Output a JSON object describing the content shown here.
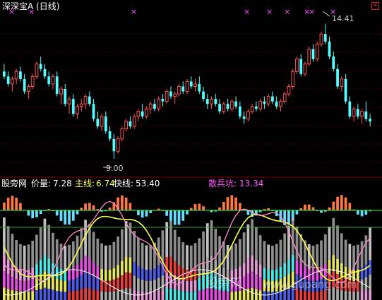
{
  "upper_panel": {
    "title": "深深宝A (日线)",
    "high_annotation": "14.41",
    "low_annotation": "9.00",
    "signal_marker": "×"
  },
  "lower_panel": {
    "indicator_name": "股旁网",
    "price_label": "价量:",
    "price_value": "7.28",
    "main_label": "主线:",
    "main_value": "6.74",
    "fast_label": "快线:",
    "fast_value": "53.40",
    "retail_label": "散兵坑:",
    "retail_value": "13.34"
  },
  "watermark": {
    "cn": "股旁网",
    "en": "www.gupang.com"
  },
  "colors": {
    "up": "#ff5555",
    "down": "#55ffff",
    "grid": "#7a0000",
    "price_label": "#ffffff",
    "main_label": "#ffff55",
    "fast_label": "#ffffff",
    "retail_label": "#ff55ff",
    "marker": "#ff55ff",
    "main_line": "#ffff44",
    "fast_line": "#ff88cc"
  },
  "chart_data": [
    {
      "type": "candlestick",
      "title": "深深宝A (日线)",
      "candles": [
        [
          12.5,
          12.8,
          12.2,
          12.3
        ],
        [
          12.3,
          12.5,
          11.9,
          12.0
        ],
        [
          12.0,
          12.3,
          11.7,
          12.2
        ],
        [
          12.2,
          12.6,
          12.0,
          12.5
        ],
        [
          12.5,
          12.7,
          12.1,
          12.2
        ],
        [
          12.2,
          12.4,
          11.6,
          11.7
        ],
        [
          11.7,
          12.0,
          11.4,
          11.9
        ],
        [
          11.9,
          12.4,
          11.8,
          12.3
        ],
        [
          12.3,
          12.9,
          12.2,
          12.8
        ],
        [
          12.8,
          13.1,
          12.5,
          12.6
        ],
        [
          12.6,
          12.8,
          12.2,
          12.3
        ],
        [
          12.3,
          12.5,
          11.9,
          12.0
        ],
        [
          12.0,
          12.4,
          11.8,
          12.3
        ],
        [
          12.3,
          12.5,
          11.5,
          11.6
        ],
        [
          11.6,
          11.9,
          11.2,
          11.8
        ],
        [
          11.8,
          12.0,
          11.1,
          11.2
        ],
        [
          11.2,
          11.5,
          10.8,
          11.4
        ],
        [
          11.4,
          11.6,
          10.7,
          10.8
        ],
        [
          10.8,
          11.2,
          10.6,
          11.1
        ],
        [
          11.1,
          11.4,
          10.9,
          11.2
        ],
        [
          11.2,
          11.6,
          11.0,
          11.5
        ],
        [
          11.5,
          11.7,
          11.1,
          11.2
        ],
        [
          11.2,
          11.4,
          10.5,
          10.6
        ],
        [
          10.6,
          10.9,
          10.2,
          10.3
        ],
        [
          10.3,
          10.8,
          10.1,
          10.7
        ],
        [
          10.7,
          10.9,
          10.0,
          10.1
        ],
        [
          10.1,
          10.3,
          9.7,
          9.8
        ],
        [
          9.8,
          10.0,
          9.0,
          9.3
        ],
        [
          9.3,
          9.9,
          9.2,
          9.8
        ],
        [
          9.8,
          10.3,
          9.7,
          10.2
        ],
        [
          10.2,
          10.6,
          10.1,
          10.5
        ],
        [
          10.5,
          10.7,
          10.2,
          10.3
        ],
        [
          10.3,
          10.8,
          10.2,
          10.7
        ],
        [
          10.7,
          11.0,
          10.5,
          10.9
        ],
        [
          10.9,
          11.2,
          10.6,
          10.7
        ],
        [
          10.7,
          11.1,
          10.6,
          11.0
        ],
        [
          11.0,
          11.3,
          10.8,
          11.2
        ],
        [
          11.2,
          11.4,
          10.9,
          11.0
        ],
        [
          11.0,
          11.5,
          10.9,
          11.4
        ],
        [
          11.4,
          11.6,
          11.1,
          11.3
        ],
        [
          11.3,
          11.8,
          11.2,
          11.7
        ],
        [
          11.7,
          11.9,
          11.4,
          11.5
        ],
        [
          11.5,
          11.7,
          11.2,
          11.6
        ],
        [
          11.6,
          12.0,
          11.5,
          11.9
        ],
        [
          11.9,
          12.1,
          11.6,
          11.7
        ],
        [
          11.7,
          12.2,
          11.6,
          12.1
        ],
        [
          12.1,
          12.3,
          11.8,
          11.9
        ],
        [
          11.9,
          12.2,
          11.7,
          12.0
        ],
        [
          12.0,
          12.3,
          11.6,
          11.7
        ],
        [
          11.7,
          11.9,
          11.3,
          11.4
        ],
        [
          11.4,
          11.6,
          11.0,
          11.2
        ],
        [
          11.2,
          11.5,
          11.0,
          11.4
        ],
        [
          11.4,
          11.6,
          11.1,
          11.2
        ],
        [
          11.2,
          11.4,
          10.8,
          10.9
        ],
        [
          10.9,
          11.3,
          10.8,
          11.2
        ],
        [
          11.2,
          11.4,
          10.9,
          11.0
        ],
        [
          11.0,
          11.4,
          10.9,
          11.3
        ],
        [
          11.3,
          11.5,
          11.0,
          11.1
        ],
        [
          11.1,
          11.3,
          10.6,
          10.7
        ],
        [
          10.7,
          10.9,
          10.4,
          10.6
        ],
        [
          10.6,
          11.0,
          10.5,
          10.9
        ],
        [
          10.9,
          11.2,
          10.8,
          11.1
        ],
        [
          11.1,
          11.3,
          10.9,
          11.0
        ],
        [
          11.0,
          11.4,
          10.9,
          11.3
        ],
        [
          11.3,
          11.5,
          11.0,
          11.2
        ],
        [
          11.2,
          11.6,
          11.1,
          11.5
        ],
        [
          11.5,
          11.7,
          11.2,
          11.3
        ],
        [
          11.3,
          11.5,
          11.0,
          11.1
        ],
        [
          11.1,
          11.4,
          10.9,
          11.3
        ],
        [
          11.3,
          11.7,
          11.2,
          11.6
        ],
        [
          11.6,
          12.0,
          11.5,
          11.9
        ],
        [
          11.9,
          12.6,
          11.8,
          12.5
        ],
        [
          12.5,
          13.1,
          12.4,
          13.0
        ],
        [
          13.0,
          13.2,
          12.3,
          12.4
        ],
        [
          12.4,
          12.9,
          12.3,
          12.8
        ],
        [
          12.8,
          13.5,
          12.7,
          13.4
        ],
        [
          13.4,
          13.6,
          12.9,
          13.0
        ],
        [
          13.0,
          13.7,
          12.9,
          13.6
        ],
        [
          13.6,
          14.1,
          13.5,
          14.0
        ],
        [
          14.0,
          14.41,
          13.6,
          13.7
        ],
        [
          13.7,
          13.9,
          13.0,
          13.1
        ],
        [
          13.1,
          13.3,
          12.5,
          12.6
        ],
        [
          12.6,
          12.8,
          11.8,
          11.9
        ],
        [
          11.9,
          12.3,
          11.7,
          12.2
        ],
        [
          12.2,
          12.4,
          11.2,
          11.3
        ],
        [
          11.3,
          11.5,
          10.6,
          10.7
        ],
        [
          10.7,
          11.1,
          10.5,
          11.0
        ],
        [
          11.0,
          11.2,
          10.6,
          10.7
        ],
        [
          10.7,
          11.0,
          10.4,
          10.9
        ],
        [
          10.9,
          11.3,
          10.5,
          10.6
        ],
        [
          10.6,
          10.8,
          10.3,
          10.5
        ]
      ],
      "high_label": 14.41,
      "low_label": 9.0
    },
    {
      "type": "bar",
      "title": "股旁网",
      "series": [
        {
          "name": "价量",
          "last_value": 7.28
        },
        {
          "name": "主线",
          "last_value": 6.74
        },
        {
          "name": "快线",
          "last_value": 53.4
        },
        {
          "name": "散兵坑",
          "last_value": 13.34
        }
      ]
    }
  ]
}
